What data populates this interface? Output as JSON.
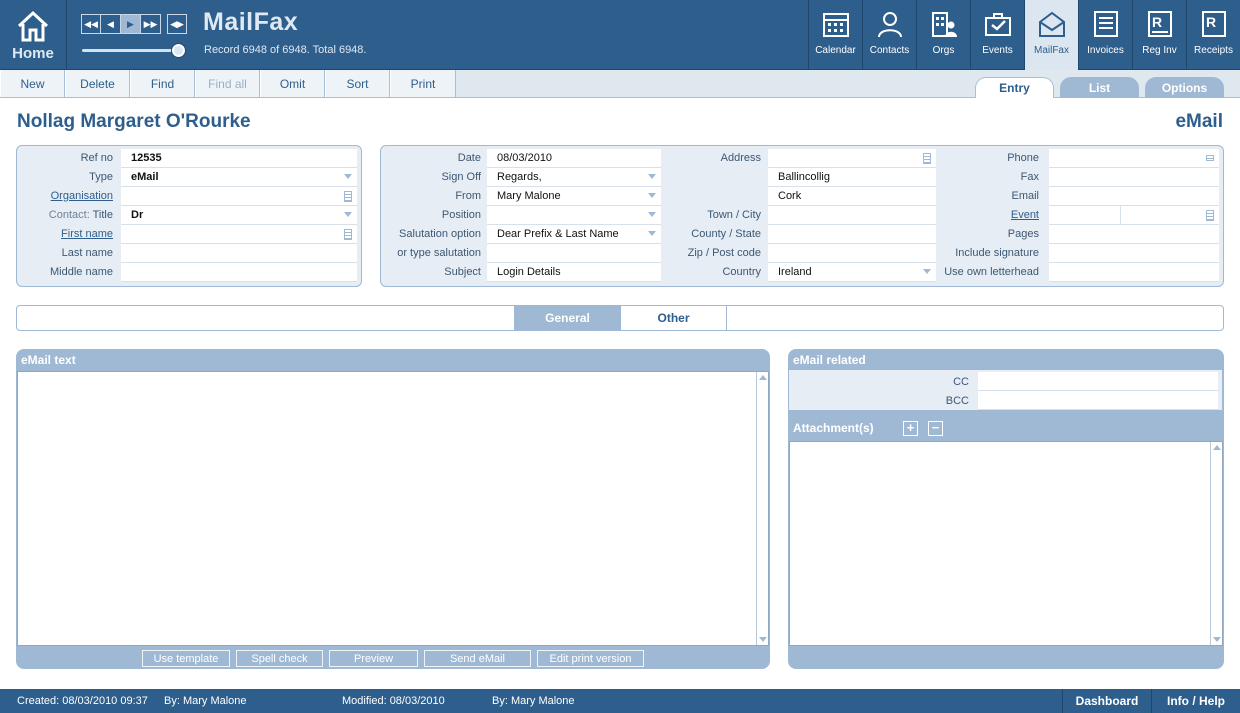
{
  "header": {
    "home_label": "Home",
    "app_title": "MailFax",
    "record_info": "Record 6948 of 6948. Total 6948.",
    "modules": [
      {
        "label": "Calendar",
        "icon": "calendar-icon"
      },
      {
        "label": "Contacts",
        "icon": "person-icon"
      },
      {
        "label": "Orgs",
        "icon": "building-icon"
      },
      {
        "label": "Events",
        "icon": "briefcase-icon"
      },
      {
        "label": "MailFax",
        "icon": "envelope-icon",
        "active": true
      },
      {
        "label": "Invoices",
        "icon": "invoice-icon"
      },
      {
        "label": "Reg Inv",
        "icon": "reg-invoice-icon"
      },
      {
        "label": "Receipts",
        "icon": "receipt-icon"
      }
    ]
  },
  "toolbar": {
    "new": "New",
    "delete": "Delete",
    "find": "Find",
    "find_all": "Find all",
    "omit": "Omit",
    "sort": "Sort",
    "print": "Print"
  },
  "view_tabs": {
    "entry": "Entry",
    "list": "List",
    "options": "Options",
    "active": "Entry"
  },
  "record": {
    "title": "Nollag Margaret O'Rourke",
    "type_heading": "eMail"
  },
  "left_panel": {
    "ref_no_label": "Ref no",
    "ref_no": "12535",
    "type_label": "Type",
    "type": "eMail",
    "organisation_label": "Organisation",
    "organisation": "",
    "contact_label": "Contact:",
    "title_label": "Title",
    "title": "Dr",
    "first_name_label": "First name",
    "first_name": "",
    "last_name_label": "Last name",
    "last_name": "",
    "middle_name_label": "Middle name",
    "middle_name": ""
  },
  "mid_panel": {
    "date_label": "Date",
    "date": "08/03/2010",
    "sign_off_label": "Sign Off",
    "sign_off": "Regards,",
    "from_label": "From",
    "from": "Mary Malone",
    "position_label": "Position",
    "position": "",
    "salutation_label": "Salutation option",
    "salutation": "Dear Prefix & Last Name",
    "type_salutation_label": "or type salutation",
    "type_salutation": "",
    "subject_label": "Subject",
    "subject": "Login Details"
  },
  "address_panel": {
    "address_label": "Address",
    "address_line1": "",
    "address_line2": "Ballincollig",
    "address_line3": "Cork",
    "town_label": "Town / City",
    "town": "",
    "county_label": "County / State",
    "county": "",
    "zip_label": "Zip / Post code",
    "zip": "",
    "country_label": "Country",
    "country": "Ireland"
  },
  "right_panel": {
    "phone_label": "Phone",
    "phone": "",
    "fax_label": "Fax",
    "fax": "",
    "email_label": "Email",
    "email": "",
    "event_label": "Event",
    "event": "",
    "pages_label": "Pages",
    "pages": "",
    "include_signature_label": "Include signature",
    "include_signature": false,
    "own_letterhead_label": "Use own letterhead",
    "own_letterhead": false
  },
  "sub_tabs": {
    "general": "General",
    "other": "Other",
    "active": "General"
  },
  "email_text": {
    "heading": "eMail text",
    "body": "",
    "use_template": "Use template",
    "spell_check": "Spell check",
    "preview": "Preview",
    "send_email": "Send eMail",
    "edit_print": "Edit print version"
  },
  "email_related": {
    "heading": "eMail related",
    "cc_label": "CC",
    "cc": "",
    "bcc_label": "BCC",
    "bcc": "",
    "attachments_label": "Attachment(s)",
    "add": "+",
    "remove": "−"
  },
  "footer": {
    "created": "Created:  08/03/2010   09:37",
    "created_by": "By:  Mary Malone",
    "modified": "Modified:  08/03/2010",
    "modified_by": "By:  Mary Malone",
    "dashboard": "Dashboard",
    "info_help": "Info / Help"
  },
  "colors": {
    "brand": "#2e5e8c",
    "light": "#9fb9d4",
    "panel": "#e6edf4"
  }
}
